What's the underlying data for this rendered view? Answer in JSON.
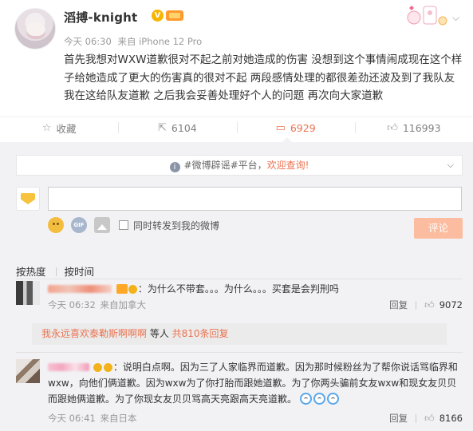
{
  "post": {
    "author": "滔搏-knight",
    "time": "今天 06:30",
    "source": "来自 iPhone 12 Pro",
    "text": "首先我想对WXW道歉很对不起之前对她造成的伤害 没想到这个事情闹成现在这个样子给她造成了更大的伤害真的很对不起 两段感情处理的都很差劲还波及到了我队友 我在这给队友道歉 之后我会妥善处理好个人的问题 再次向大家道歉"
  },
  "actions": {
    "favorite": "收藏",
    "repost_count": "6104",
    "comment_count": "6929",
    "like_count": "116993"
  },
  "notice": {
    "prefix": "#微博辟谣#平台，",
    "link": "欢迎查询!"
  },
  "composer": {
    "forward_label": "同时转发到我的微博",
    "submit_label": "评论"
  },
  "sort": {
    "hot": "按热度",
    "time": "按时间"
  },
  "comments": [
    {
      "text": "：为什么不带套。。。为什么。。。买套是会判刑吗",
      "time": "今天 06:32",
      "source": "来自加拿大",
      "reply_label": "回复",
      "likes": "9072",
      "subreply": {
        "who": "我永远喜欢泰勒斯啊啊啊",
        "mid": " 等人 ",
        "more": "共810条回复"
      }
    },
    {
      "text": "：说明白点啊。因为三了人家临界而道歉。因为那时候粉丝为了帮你说话骂临界和wxw，向他们俩道歉。因为wxw为了你打胎而跟她道歉。为了你两头骗前女友wxw和现女友贝贝而跟她俩道歉。为了你现女友贝贝骂高天亮跟高天亮道歉。",
      "time": "今天 06:41",
      "source": "来自日本",
      "reply_label": "回复",
      "likes": "8166"
    }
  ]
}
